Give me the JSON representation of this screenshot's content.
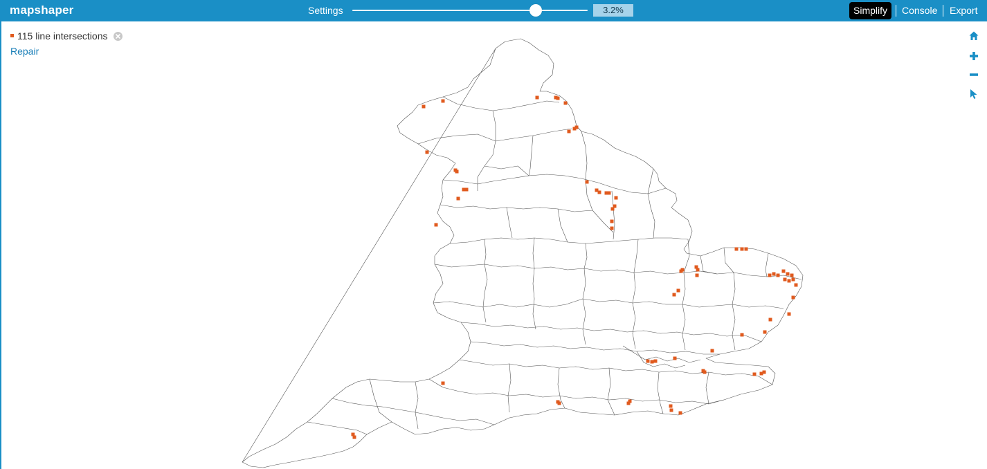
{
  "app": {
    "brand": "mapshaper",
    "accent": "#1a8fc6",
    "intersection_color": "#e05a1e"
  },
  "toolbar": {
    "settings_label": "Settings",
    "simplify_pct": "3.2%",
    "simplify_level": 0.78
  },
  "nav": {
    "simplify": "Simplify",
    "console": "Console",
    "export": "Export"
  },
  "info": {
    "intersections": "115 line intersections",
    "repair": "Repair"
  },
  "tools": [
    "home-icon",
    "zoom-in-icon",
    "zoom-out-icon",
    "pointer-icon"
  ]
}
